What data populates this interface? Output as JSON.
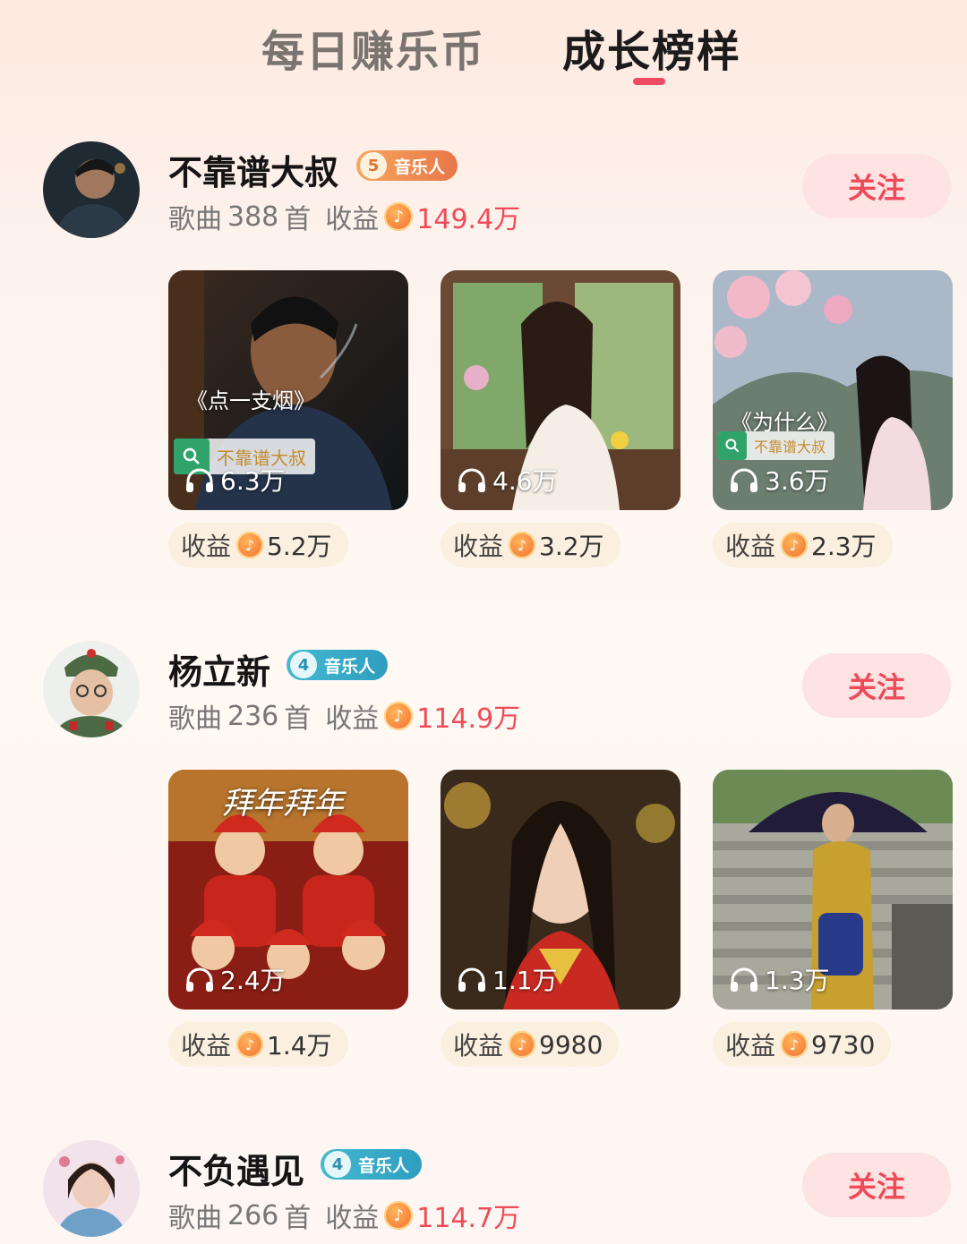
{
  "tabs": [
    {
      "label": "每日赚乐币",
      "active": false
    },
    {
      "label": "成长榜样",
      "active": true
    }
  ],
  "labels": {
    "songs_prefix": "歌曲",
    "songs_suffix": "首",
    "earnings": "收益",
    "follow": "关注"
  },
  "colors": {
    "accent": "#ef4c63",
    "follow_bg": "#fde3e1",
    "earning_pill": "#fbefdf"
  },
  "creators": [
    {
      "name": "不靠谱大叔",
      "level": "5",
      "badge": "音乐人",
      "songs": "388",
      "earnings": "149.4万",
      "works": [
        {
          "title": "《点一支烟》",
          "tag": "不靠谱大叔",
          "plays": "6.3万",
          "earnings": "5.2万"
        },
        {
          "title": "",
          "tag": "",
          "plays": "4.6万",
          "earnings": "3.2万"
        },
        {
          "title": "《为什么》",
          "tag": "不靠谱大叔",
          "plays": "3.6万",
          "earnings": "2.3万"
        }
      ]
    },
    {
      "name": "杨立新",
      "level": "4",
      "badge": "音乐人",
      "songs": "236",
      "earnings": "114.9万",
      "works": [
        {
          "title": "拜年拜年",
          "tag": "",
          "plays": "2.4万",
          "earnings": "1.4万"
        },
        {
          "title": "",
          "tag": "",
          "plays": "1.1万",
          "earnings": "9980"
        },
        {
          "title": "",
          "tag": "",
          "plays": "1.3万",
          "earnings": "9730"
        }
      ]
    },
    {
      "name": "不负遇见",
      "level": "4",
      "badge": "音乐人",
      "songs": "266",
      "earnings": "114.7万"
    }
  ]
}
